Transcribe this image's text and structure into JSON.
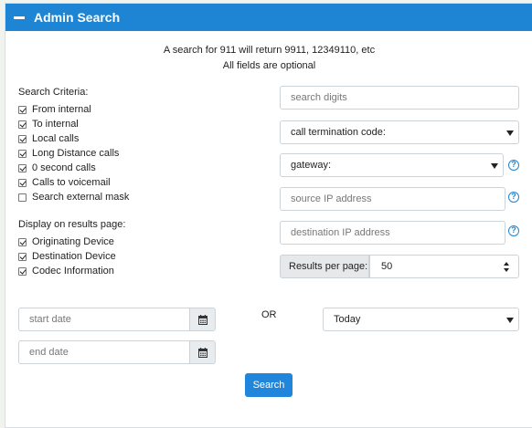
{
  "header": {
    "title": "Admin Search"
  },
  "info": {
    "line1": "A search for 911 will return 9911, 12349110, etc",
    "line2": "All fields are optional"
  },
  "criteria": {
    "label": "Search Criteria:",
    "items": [
      {
        "label": "From internal",
        "checked": true
      },
      {
        "label": "To internal",
        "checked": true
      },
      {
        "label": "Local calls",
        "checked": true
      },
      {
        "label": "Long Distance calls",
        "checked": true
      },
      {
        "label": "0 second calls",
        "checked": true
      },
      {
        "label": "Calls to voicemail",
        "checked": true
      },
      {
        "label": "Search external mask",
        "checked": false
      }
    ]
  },
  "display": {
    "label": "Display on results page:",
    "items": [
      {
        "label": "Originating Device",
        "checked": true
      },
      {
        "label": "Destination Device",
        "checked": true
      },
      {
        "label": "Codec Information",
        "checked": true
      }
    ]
  },
  "fields": {
    "search_digits_placeholder": "search digits",
    "termination_code": "call termination code:",
    "gateway": "gateway:",
    "source_ip_placeholder": "source IP address",
    "dest_ip_placeholder": "destination IP address",
    "help_glyph": "?",
    "results_per_page_label": "Results per page:",
    "results_per_page_value": "50"
  },
  "dates": {
    "start_placeholder": "start date",
    "end_placeholder": "end date",
    "or": "OR",
    "range_value": "Today"
  },
  "search_button": "Search",
  "colors": {
    "accent": "#1d85d4",
    "background": "#f1f4ee"
  },
  "icons": [
    "minus-icon",
    "checkbox-icon",
    "chevron-down-icon",
    "help-icon",
    "up-down-icon",
    "calendar-icon"
  ]
}
